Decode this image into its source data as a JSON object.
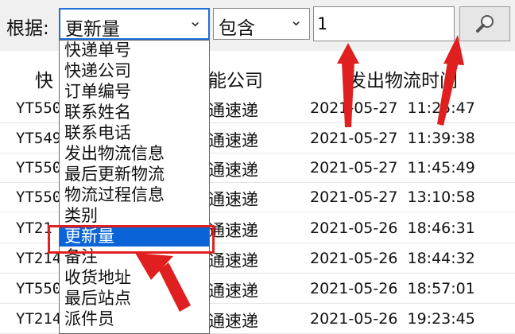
{
  "toolbar": {
    "by_label": "根据:",
    "field_value": "更新量",
    "operator_value": "包含",
    "search_value": "1"
  },
  "columns": [
    "快",
    "能公司",
    "发出物流时间"
  ],
  "rows": [
    {
      "id": "YT550",
      "company": "通速递",
      "time": "2021-05-27  11:25:47"
    },
    {
      "id": "YT549",
      "company": "通速递",
      "time": "2021-05-27  11:39:38"
    },
    {
      "id": "YT550",
      "company": "通速递",
      "time": "2021-05-27  11:45:49"
    },
    {
      "id": "YT550",
      "company": "通速递",
      "time": "2021-05-27  13:10:58"
    },
    {
      "id": "YT21",
      "company": "通速递",
      "time": "2021-05-26  18:46:31"
    },
    {
      "id": "YT214",
      "company": "通速递",
      "time": "2021-05-26  18:44:32"
    },
    {
      "id": "YT550",
      "company": "通速递",
      "time": "2021-05-26  18:57:01"
    },
    {
      "id": "YT214",
      "company": "通速递",
      "time": "2021-05-26  19:23:45"
    }
  ],
  "dropdown": {
    "items": [
      "快递单号",
      "快递公司",
      "订单编号",
      "联系姓名",
      "联系电话",
      "发出物流信息",
      "最后更新物流",
      "物流过程信息",
      "类别",
      "更新量",
      "备注",
      "收货地址",
      "最后站点",
      "派件员"
    ],
    "selected_index": 9
  },
  "colors": {
    "selection": "#0a64d8",
    "annotation": "#e02020"
  },
  "icons": {
    "search": "magnifier-icon",
    "dropdown": "chevron-down-icon"
  }
}
